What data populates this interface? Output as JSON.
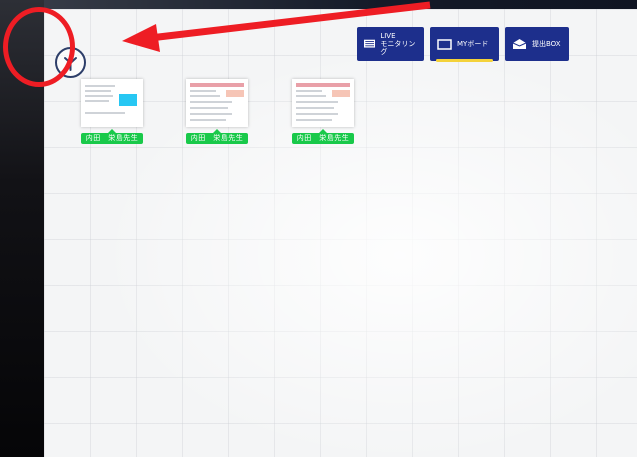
{
  "toolbar": {
    "live_label_line1": "LIVE",
    "live_label_line2": "モニタリング",
    "myboard_label": "MYボード",
    "submit_box_label": "提出BOX"
  },
  "cards": [
    {
      "tag": "内田　栄島先生"
    },
    {
      "tag": "内田　栄島先生"
    },
    {
      "tag": "内田　栄島先生"
    }
  ],
  "icons": {
    "clock": "clock-icon",
    "live": "monitor-icon",
    "myboard": "board-icon",
    "submit_box": "inbox-icon"
  },
  "colors": {
    "toolbar_button": "#1d2f8c",
    "active_indicator": "#f4d23a",
    "tag_green": "#19c94a",
    "annotation_red": "#ee1d24"
  }
}
